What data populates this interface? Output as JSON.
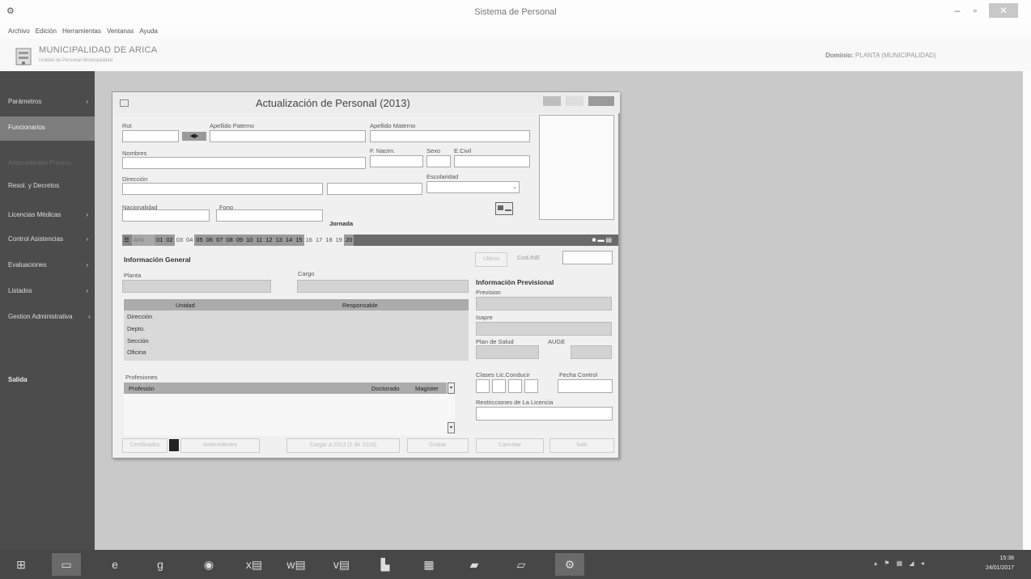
{
  "window": {
    "title": "Sistema de Personal",
    "min": "–",
    "max": "▫",
    "close": "✕"
  },
  "menu": [
    "Archivo",
    "Edición",
    "Herramientas",
    "Ventanas",
    "Ayuda"
  ],
  "header": {
    "org": "MUNICIPALIDAD DE ARICA",
    "sub": "Unidad de Personal Municipalidad",
    "domain_label": "Dominio:",
    "domain_value": "PLANTA (MUNICIPALIDAD)"
  },
  "sidebar": [
    {
      "label": "Parámetros",
      "chev": "›"
    },
    {
      "label": "Funcionarios",
      "chev": ""
    },
    {
      "label": "Antecedentes Previos",
      "chev": ""
    },
    {
      "label": "Resol. y Decretos",
      "chev": ""
    },
    {
      "label": "Licencias Médicas",
      "chev": "›"
    },
    {
      "label": "Control Asistencias",
      "chev": "›"
    },
    {
      "label": "Evaluaciones",
      "chev": "›"
    },
    {
      "label": "Listados",
      "chev": "›"
    },
    {
      "label": "Gestion Administrativa",
      "chev": "›"
    },
    {
      "label": "Salida",
      "chev": ""
    }
  ],
  "dialog": {
    "title": "Actualización de Personal (2013)",
    "labels": {
      "rut": "Rut",
      "ap_paterno": "Apellido Paterno",
      "ap_materno": "Apellido Materno",
      "nombres": "Nombres",
      "f_nacim": "F. Nacim.",
      "sexo": "Sexo",
      "e_civil": "E.Civil",
      "direccion": "Dirección",
      "escolaridad": "Escolaridad",
      "nacionalidad": "Nacionalidad",
      "fono": "Fono",
      "jornada": "Jornada",
      "info_general": "Información General",
      "planta": "Planta",
      "cargo": "Cargo",
      "info_previsional": "Información Previsional",
      "prevision": "Prevision",
      "isapre": "Isapre",
      "plan_salud": "Plan de Salud",
      "auge": "AUGE",
      "clases_lic": "Clases Lic.Conducir",
      "fecha_control": "Fecha Control",
      "restricciones": "Restricciones de La Licencia",
      "profesiones": "Profesiones",
      "cod_ine": "Cod.INE",
      "ultimo": "Ultimo"
    },
    "tabs": [
      {
        "t": "01",
        "d": true
      },
      {
        "t": "02",
        "d": true
      },
      {
        "t": "03",
        "d": false
      },
      {
        "t": "04",
        "d": false
      },
      {
        "t": "05",
        "d": true
      },
      {
        "t": "06",
        "d": true
      },
      {
        "t": "07",
        "d": true
      },
      {
        "t": "08",
        "d": true
      },
      {
        "t": "09",
        "d": true
      },
      {
        "t": "10",
        "d": true
      },
      {
        "t": "11",
        "d": true
      },
      {
        "t": "12",
        "d": true
      },
      {
        "t": "13",
        "d": true
      },
      {
        "t": "14",
        "d": true
      },
      {
        "t": "15",
        "d": true
      },
      {
        "t": "16",
        "d": false
      },
      {
        "t": "17",
        "d": false
      },
      {
        "t": "18",
        "d": false
      },
      {
        "t": "19",
        "d": false
      },
      {
        "t": "20",
        "d": true
      }
    ],
    "unidad_grid": {
      "headers": [
        "Unidad",
        "Responsable"
      ],
      "rows": [
        "Dirección",
        "Depto.",
        "Sección",
        "Oficina"
      ]
    },
    "prof_grid": {
      "headers": [
        "Profesión",
        "Doctorado",
        "Magister"
      ]
    },
    "buttons": [
      "Certificados",
      "Antecedentes",
      "Cargar a 2013 (1 de 1016)",
      "Grabar",
      "Cancelar",
      "Salir"
    ]
  },
  "taskbar": {
    "time": "15:38",
    "date": "24/01/2017",
    "tray": "▴ ⚑ ▦ ◢ ◂"
  }
}
